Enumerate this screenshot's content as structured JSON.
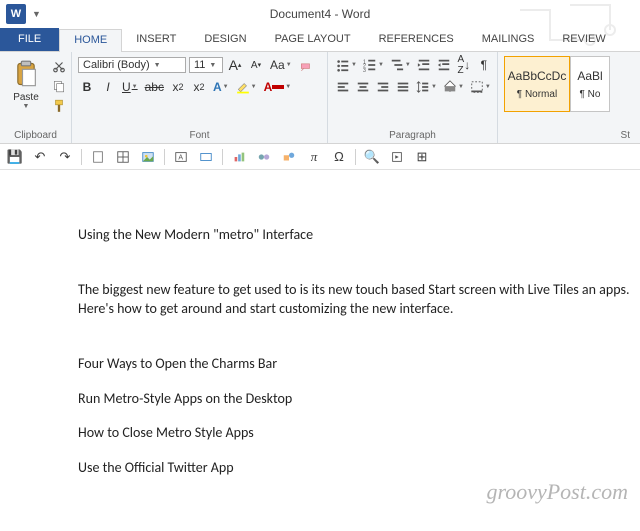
{
  "window": {
    "title": "Document4 - Word"
  },
  "tabs": {
    "file": "FILE",
    "home": "HOME",
    "insert": "INSERT",
    "design": "DESIGN",
    "page_layout": "PAGE LAYOUT",
    "references": "REFERENCES",
    "mailings": "MAILINGS",
    "review": "REVIEW"
  },
  "ribbon": {
    "clipboard": {
      "label": "Clipboard",
      "paste": "Paste"
    },
    "font": {
      "label": "Font",
      "name": "Calibri (Body)",
      "size": "11",
      "grow": "A",
      "shrink": "A",
      "case": "Aa",
      "bold": "B",
      "italic": "I",
      "underline": "U",
      "strike": "abc",
      "sub": "x",
      "sup": "x"
    },
    "paragraph": {
      "label": "Paragraph"
    },
    "styles": {
      "label": "St",
      "normal_preview": "AaBbCcDc",
      "normal_name": "¶ Normal",
      "nospace_preview": "AaBl",
      "nospace_name": "¶ No"
    }
  },
  "document": {
    "heading": "Using the New Modern \"metro\" Interface",
    "para1": "The biggest new feature to get used to is its new touch based Start screen with Live Tiles an apps. Here's how to get around and start customizing the new interface.",
    "item1": "Four Ways to Open the Charms Bar",
    "item2": "Run Metro-Style Apps on the Desktop",
    "item3": "How to Close Metro Style Apps",
    "item4": "Use the Official Twitter App"
  },
  "watermark": "groovyPost.com"
}
